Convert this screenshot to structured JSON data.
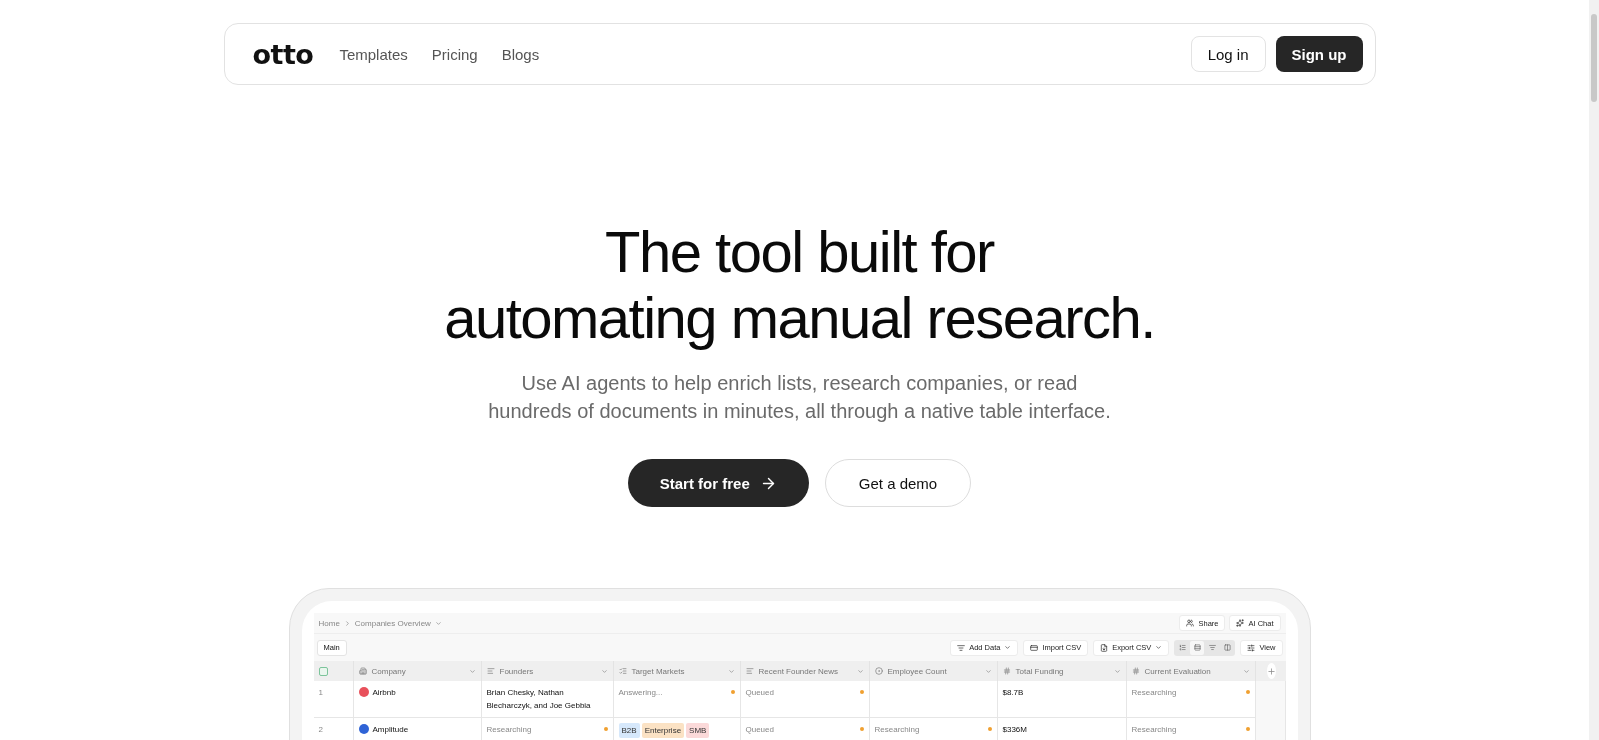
{
  "nav": {
    "logo": "otto",
    "links": [
      "Templates",
      "Pricing",
      "Blogs"
    ],
    "login": "Log in",
    "signup": "Sign up"
  },
  "hero": {
    "title_lines": [
      "The tool built for",
      "automating manual research."
    ],
    "subtitle_lines": [
      "Use AI agents to help enrich lists, research companies, or read",
      "hundreds of documents in minutes, all through a native table interface."
    ],
    "primary": "Start for free",
    "secondary": "Get a demo"
  },
  "app": {
    "breadcrumb": [
      "Home",
      "Companies Overview"
    ],
    "share": "Share",
    "ai_chat": "AI Chat",
    "tabs": [
      {
        "label": "Main",
        "selected": true
      }
    ],
    "toolbar": [
      {
        "kind": "add",
        "label": "Add Data",
        "dropdown": true
      },
      {
        "kind": "import",
        "label": "Import CSV",
        "dropdown": false
      },
      {
        "kind": "export",
        "label": "Export CSV",
        "dropdown": true
      }
    ],
    "row_heights": [
      {
        "selected": false
      },
      {
        "selected": true
      },
      {
        "selected": false
      },
      {
        "selected": false
      }
    ],
    "view": "View",
    "columns": [
      {
        "kind": "select",
        "checked": false
      },
      {
        "kind": "company",
        "label": "Company"
      },
      {
        "kind": "text",
        "label": "Founders"
      },
      {
        "kind": "list",
        "label": "Target Markets"
      },
      {
        "kind": "text",
        "label": "Recent Founder News"
      },
      {
        "kind": "count",
        "label": "Employee Count"
      },
      {
        "kind": "number",
        "label": "Total Funding"
      },
      {
        "kind": "number",
        "label": "Current Evaluation"
      }
    ],
    "rows": [
      {
        "cells": [
          {
            "text": "1",
            "pending": false,
            "muted": true
          },
          {
            "text": "Airbnb",
            "color": "#e8505b",
            "pending": false,
            "muted": false
          },
          {
            "text": "Brian Chesky, Nathan Blecharczyk, and Joe Gebbia",
            "pending": false,
            "muted": false
          },
          {
            "text": "Answering...",
            "pending": true,
            "muted": true
          },
          {
            "text": "Queued",
            "pending": true,
            "muted": true
          },
          {
            "pending": false
          },
          {
            "text": "$8.7B",
            "pending": false,
            "muted": false
          },
          {
            "text": "Researching",
            "pending": true,
            "muted": true
          }
        ]
      },
      {
        "cells": [
          {
            "text": "2",
            "pending": false,
            "muted": true
          },
          {
            "text": "Amplitude",
            "color": "#2f63d6",
            "pending": false,
            "muted": false
          },
          {
            "text": "Researching",
            "pending": true,
            "muted": true
          },
          {
            "tags": [
              {
                "label": "B2B",
                "color": "#d6e8fb"
              },
              {
                "label": "Enterprise",
                "color": "#fbe2c4"
              },
              {
                "label": "SMB",
                "color": "#fbd9d9"
              }
            ],
            "pending": false
          },
          {
            "text": "Queued",
            "pending": true,
            "muted": true
          },
          {
            "text": "Researching",
            "pending": true,
            "muted": true
          },
          {
            "text": "$336M",
            "pending": false,
            "muted": false
          },
          {
            "text": "Researching",
            "pending": true,
            "muted": true
          }
        ]
      }
    ]
  }
}
